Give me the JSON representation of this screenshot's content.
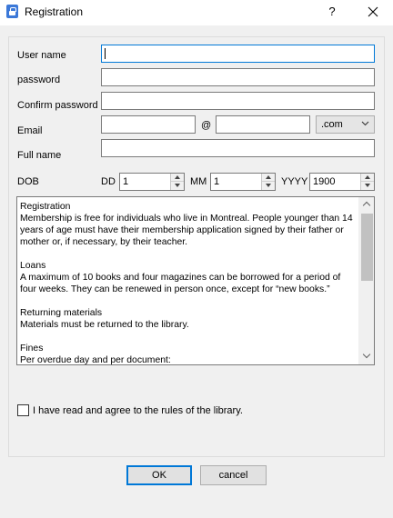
{
  "window": {
    "title": "Registration",
    "help_label": "?",
    "close_icon": "close-icon",
    "app_icon": "registration-app-icon"
  },
  "form": {
    "username": {
      "label": "User name",
      "value": ""
    },
    "password": {
      "label": "password",
      "value": ""
    },
    "confirm_password": {
      "label": "Confirm password",
      "value": ""
    },
    "email": {
      "label": "Email",
      "local_value": "",
      "at_sign": "@",
      "domain_value": "",
      "tld_selected": ".com"
    },
    "full_name": {
      "label": "Full name",
      "value": ""
    },
    "dob": {
      "label": "DOB",
      "dd_label": "DD",
      "dd_value": "1",
      "mm_label": "MM",
      "mm_value": "1",
      "yyyy_label": "YYYY",
      "yyyy_value": "1900"
    }
  },
  "rules": [
    {
      "type": "line",
      "text": "Registration"
    },
    {
      "type": "line",
      "text": "Membership is free for individuals who live in Montreal. People younger than 14 years of age must have their membership application signed by their father or mother or, if necessary, by their teacher."
    },
    {
      "type": "gap"
    },
    {
      "type": "line",
      "text": "Loans"
    },
    {
      "type": "line",
      "text": "A maximum of 10 books and four magazines can be borrowed for a period of four weeks. They can be renewed in person once, except for “new books.”"
    },
    {
      "type": "gap"
    },
    {
      "type": "line",
      "text": "Returning materials"
    },
    {
      "type": "line",
      "text": "Materials must be returned to the  library."
    },
    {
      "type": "gap"
    },
    {
      "type": "line",
      "text": "Fines"
    },
    {
      "type": "line",
      "text": "Per overdue day and per document:"
    }
  ],
  "agreement": {
    "label": "I have read and agree to the rules of the library.",
    "checked": false
  },
  "buttons": {
    "ok": "OK",
    "cancel": "cancel"
  },
  "colors": {
    "focus_border": "#0078d7",
    "window_bg": "#f0f0f0",
    "field_border": "#7a7a7a"
  }
}
